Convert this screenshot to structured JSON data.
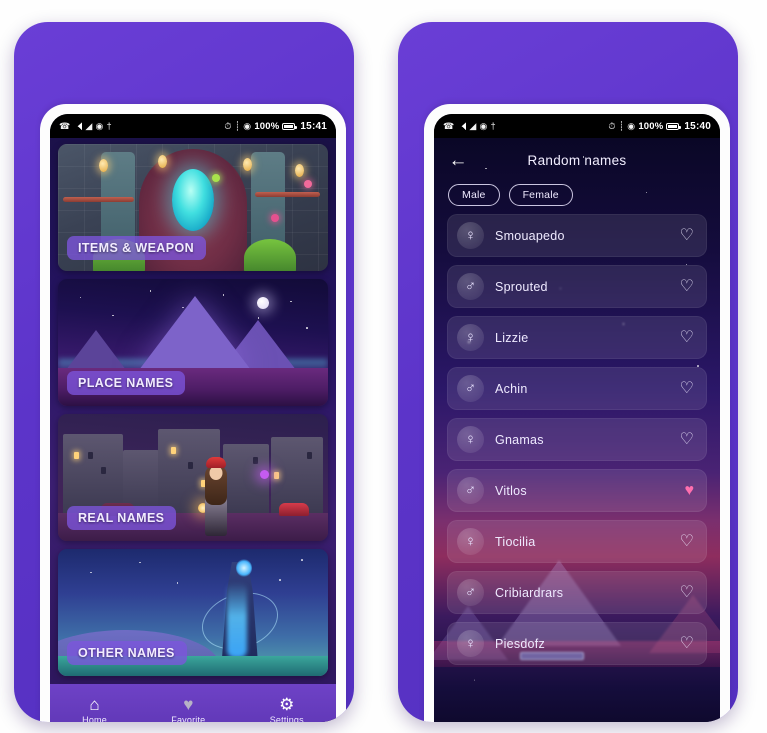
{
  "left_phone": {
    "status_bar": {
      "left_icons": [
        "phone-icon",
        "signal-icon",
        "wifi-icon",
        "eye-icon",
        "usb-icon"
      ],
      "alarm_icon": "alarm-icon",
      "bluetooth_icon": "bluetooth-icon",
      "dnd_icon": "dnd-icon",
      "battery_percent": "100%",
      "battery_icon": "battery-icon",
      "time": "15:41"
    },
    "categories": [
      {
        "label": "ITEMS & WEAPON",
        "art": "dungeon-portal"
      },
      {
        "label": "PLACE NAMES",
        "art": "night-pyramids"
      },
      {
        "label": "REAL NAMES",
        "art": "night-city-girl"
      },
      {
        "label": "OTHER NAMES",
        "art": "glowing-castle"
      }
    ],
    "bottom_nav": [
      {
        "label": "Home",
        "icon": "home-icon",
        "glyph": "⌂",
        "active": true
      },
      {
        "label": "Favorite",
        "icon": "heart-icon",
        "glyph": "♥",
        "active": false
      },
      {
        "label": "Settings",
        "icon": "gear-icon",
        "glyph": "⚙",
        "active": false
      }
    ]
  },
  "right_phone": {
    "status_bar": {
      "left_icons": [
        "phone-icon",
        "signal-icon",
        "wifi-icon",
        "eye-icon",
        "usb-icon"
      ],
      "alarm_icon": "alarm-icon",
      "bluetooth_icon": "bluetooth-icon",
      "dnd_icon": "dnd-icon",
      "battery_percent": "100%",
      "battery_icon": "battery-icon",
      "time": "15:40"
    },
    "app_bar": {
      "back_icon": "back-arrow-icon",
      "back_glyph": "←",
      "title": "Random names"
    },
    "filter_chips": [
      {
        "label": "Male",
        "selected": false
      },
      {
        "label": "Female",
        "selected": false
      }
    ],
    "names": [
      {
        "name": "Smouapedo",
        "gender": "female",
        "gender_glyph": "♀",
        "favorite": false
      },
      {
        "name": "Sprouted",
        "gender": "male",
        "gender_glyph": "♂",
        "favorite": false
      },
      {
        "name": "Lizzie",
        "gender": "female",
        "gender_glyph": "♀",
        "favorite": false
      },
      {
        "name": "Achin",
        "gender": "male",
        "gender_glyph": "♂",
        "favorite": false
      },
      {
        "name": "Gnamas",
        "gender": "female",
        "gender_glyph": "♀",
        "favorite": false
      },
      {
        "name": "Vitlos",
        "gender": "male",
        "gender_glyph": "♂",
        "favorite": true
      },
      {
        "name": "Tiocilia",
        "gender": "female",
        "gender_glyph": "♀",
        "favorite": false
      },
      {
        "name": "Cribiardrars",
        "gender": "male",
        "gender_glyph": "♂",
        "favorite": false
      },
      {
        "name": "Piesdofz",
        "gender": "female",
        "gender_glyph": "♀",
        "favorite": false
      }
    ],
    "heart_glyph": "♡",
    "heart_glyph_filled": "♥"
  },
  "colors": {
    "phone_body": "#5c34c9",
    "accent_purple": "#7c54dc",
    "nav_bar": "#6e42c6",
    "favorite_pink": "#ff6fae",
    "page_background": "#ffffff"
  }
}
